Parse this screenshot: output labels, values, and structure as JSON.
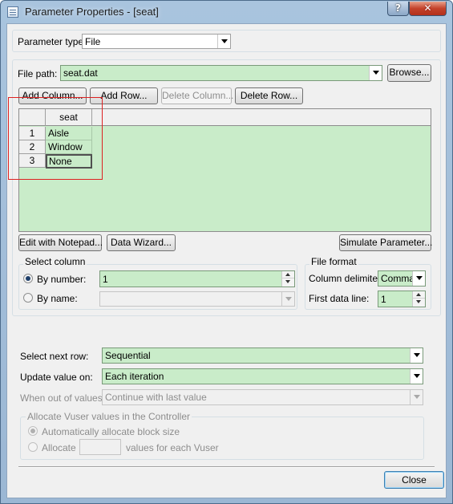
{
  "window": {
    "title": "Parameter Properties - [seat]",
    "help_label": "?",
    "close_glyph": "✕"
  },
  "param_type": {
    "label": "Parameter type:",
    "value": "File"
  },
  "file_path": {
    "label": "File path:",
    "value": "seat.dat",
    "browse_label": "Browse..."
  },
  "toolbar": {
    "add_column": "Add Column...",
    "add_row": "Add Row...",
    "delete_column": "Delete Column...",
    "delete_row": "Delete Row..."
  },
  "grid": {
    "column_header": "seat",
    "rows": [
      {
        "num": "1",
        "value": "Aisle"
      },
      {
        "num": "2",
        "value": "Window"
      },
      {
        "num": "3",
        "value": "None"
      }
    ]
  },
  "actions": {
    "edit_notepad": "Edit with Notepad...",
    "data_wizard": "Data Wizard...",
    "simulate": "Simulate Parameter..."
  },
  "select_column": {
    "title": "Select column",
    "by_number_label": "By number:",
    "by_number_value": "1",
    "by_name_label": "By name:",
    "by_name_value": ""
  },
  "file_format": {
    "title": "File format",
    "delimiter_label": "Column delimiter:",
    "delimiter_value": "Comma",
    "first_line_label": "First data line:",
    "first_line_value": "1"
  },
  "row_options": {
    "next_row_label": "Select next row:",
    "next_row_value": "Sequential",
    "update_label": "Update value on:",
    "update_value": "Each iteration",
    "out_label": "When out of values:",
    "out_value": "Continue with last value"
  },
  "allocate": {
    "title": "Allocate Vuser values in the Controller",
    "auto_label": "Automatically allocate block size",
    "allocate_label": "Allocate",
    "allocate_value": "",
    "suffix_label": "values for each Vuser"
  },
  "footer": {
    "close_label": "Close"
  },
  "colors": {
    "field_green": "#c9ecc9",
    "highlight_red": "#dd2222"
  }
}
